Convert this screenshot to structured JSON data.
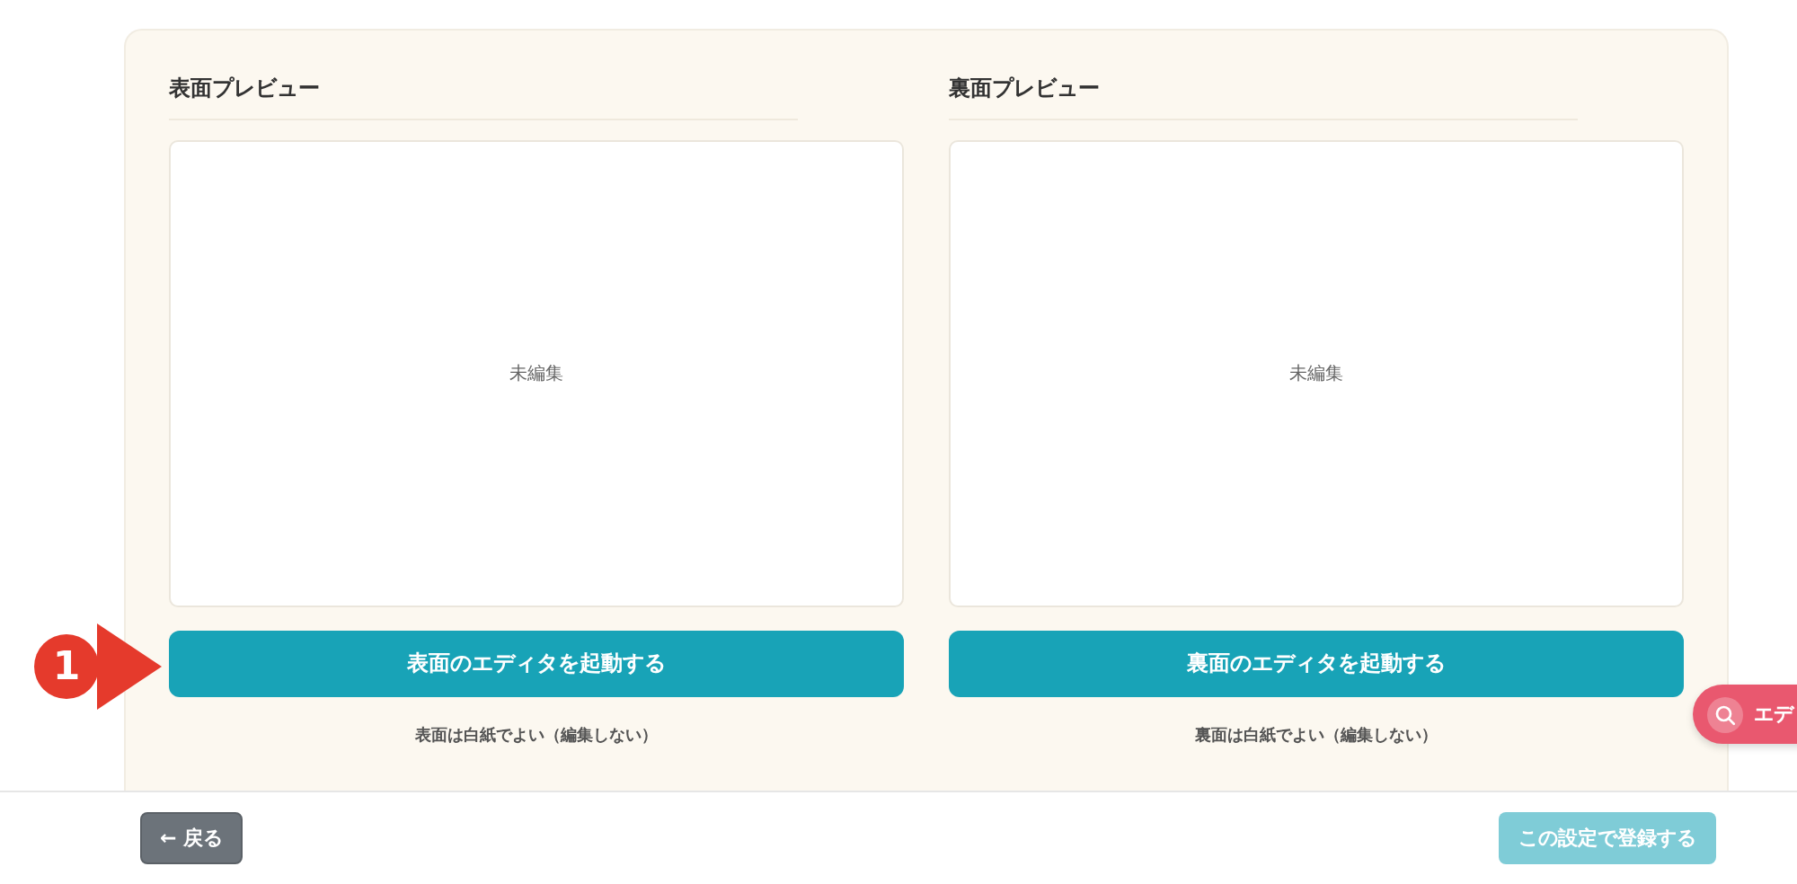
{
  "panels": [
    {
      "heading": "表面プレビュー",
      "preview_text": "未編集",
      "editor_button": "表面のエディタを起動する",
      "note": "表面は白紙でよい（編集しない）",
      "annotation": "1"
    },
    {
      "heading": "裏面プレビュー",
      "preview_text": "未編集",
      "editor_button": "裏面のエディタを起動する",
      "note": "裏面は白紙でよい（編集しない）"
    }
  ],
  "footer": {
    "back_button": {
      "label": "← 戻る",
      "disabled": false
    },
    "submit_button": {
      "label": "この設定で登録する",
      "disabled": true
    }
  },
  "floating_button": {
    "label": "エデ"
  }
}
